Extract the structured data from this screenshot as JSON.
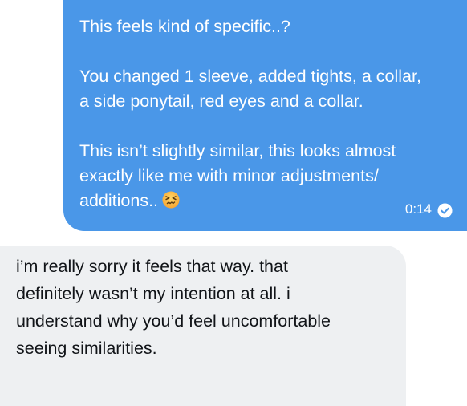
{
  "sent_message": {
    "lines_para1": [
      "This feels kind of specific..?"
    ],
    "lines_para2": [
      "You changed 1 sleeve, added tights, a collar,",
      "a side ponytail, red eyes and a collar."
    ],
    "lines_para3": [
      "This isn’t slightly similar, this looks almost",
      "exactly like me with minor adjustments/",
      "additions.."
    ],
    "emoji": "confounded-face",
    "time": "0:14",
    "status_icon": "check-circle-icon",
    "bubble_color": "#4a97e8"
  },
  "received_message": {
    "lines": [
      "i’m really sorry it feels that way. that",
      "definitely wasn’t my intention at all. i",
      "understand why you’d feel uncomfortable",
      "seeing similarities."
    ],
    "bubble_color": "#eef0f2"
  }
}
